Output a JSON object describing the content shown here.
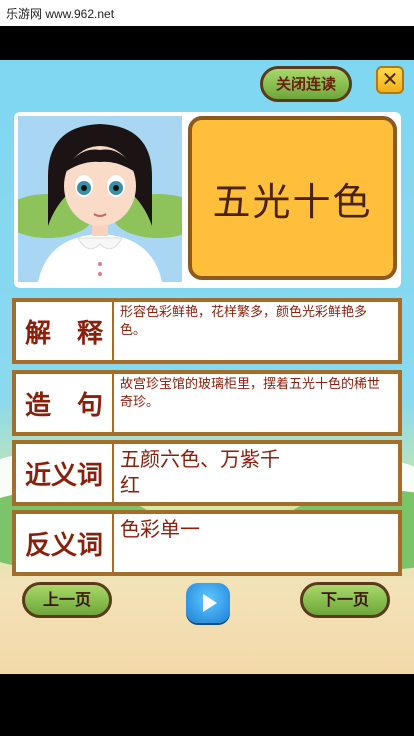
{
  "watermark": {
    "site_text": "乐游网 www.962.net"
  },
  "header": {
    "continuous_read_label": "关闭连读",
    "close_symbol": "✕"
  },
  "word": {
    "idiom": "五光十色"
  },
  "rows": [
    {
      "label": "解　释",
      "text": "形容色彩鲜艳，花样繁多，颜色光彩鲜艳多色。"
    },
    {
      "label": "造　句",
      "text": "故宫珍宝馆的玻璃柜里，摆着五光十色的稀世奇珍。"
    },
    {
      "label": "近义词",
      "text": "五颜六色、万紫千红"
    },
    {
      "label": "反义词",
      "text": "色彩单一"
    }
  ],
  "nav": {
    "prev_label": "上一页",
    "next_label": "下一页",
    "play_icon": "play-icon"
  },
  "colors": {
    "label_text": "#8a1f0b",
    "border": "#a56d2a",
    "card": "#ffbf3a",
    "button_green": "#8bc34a"
  }
}
